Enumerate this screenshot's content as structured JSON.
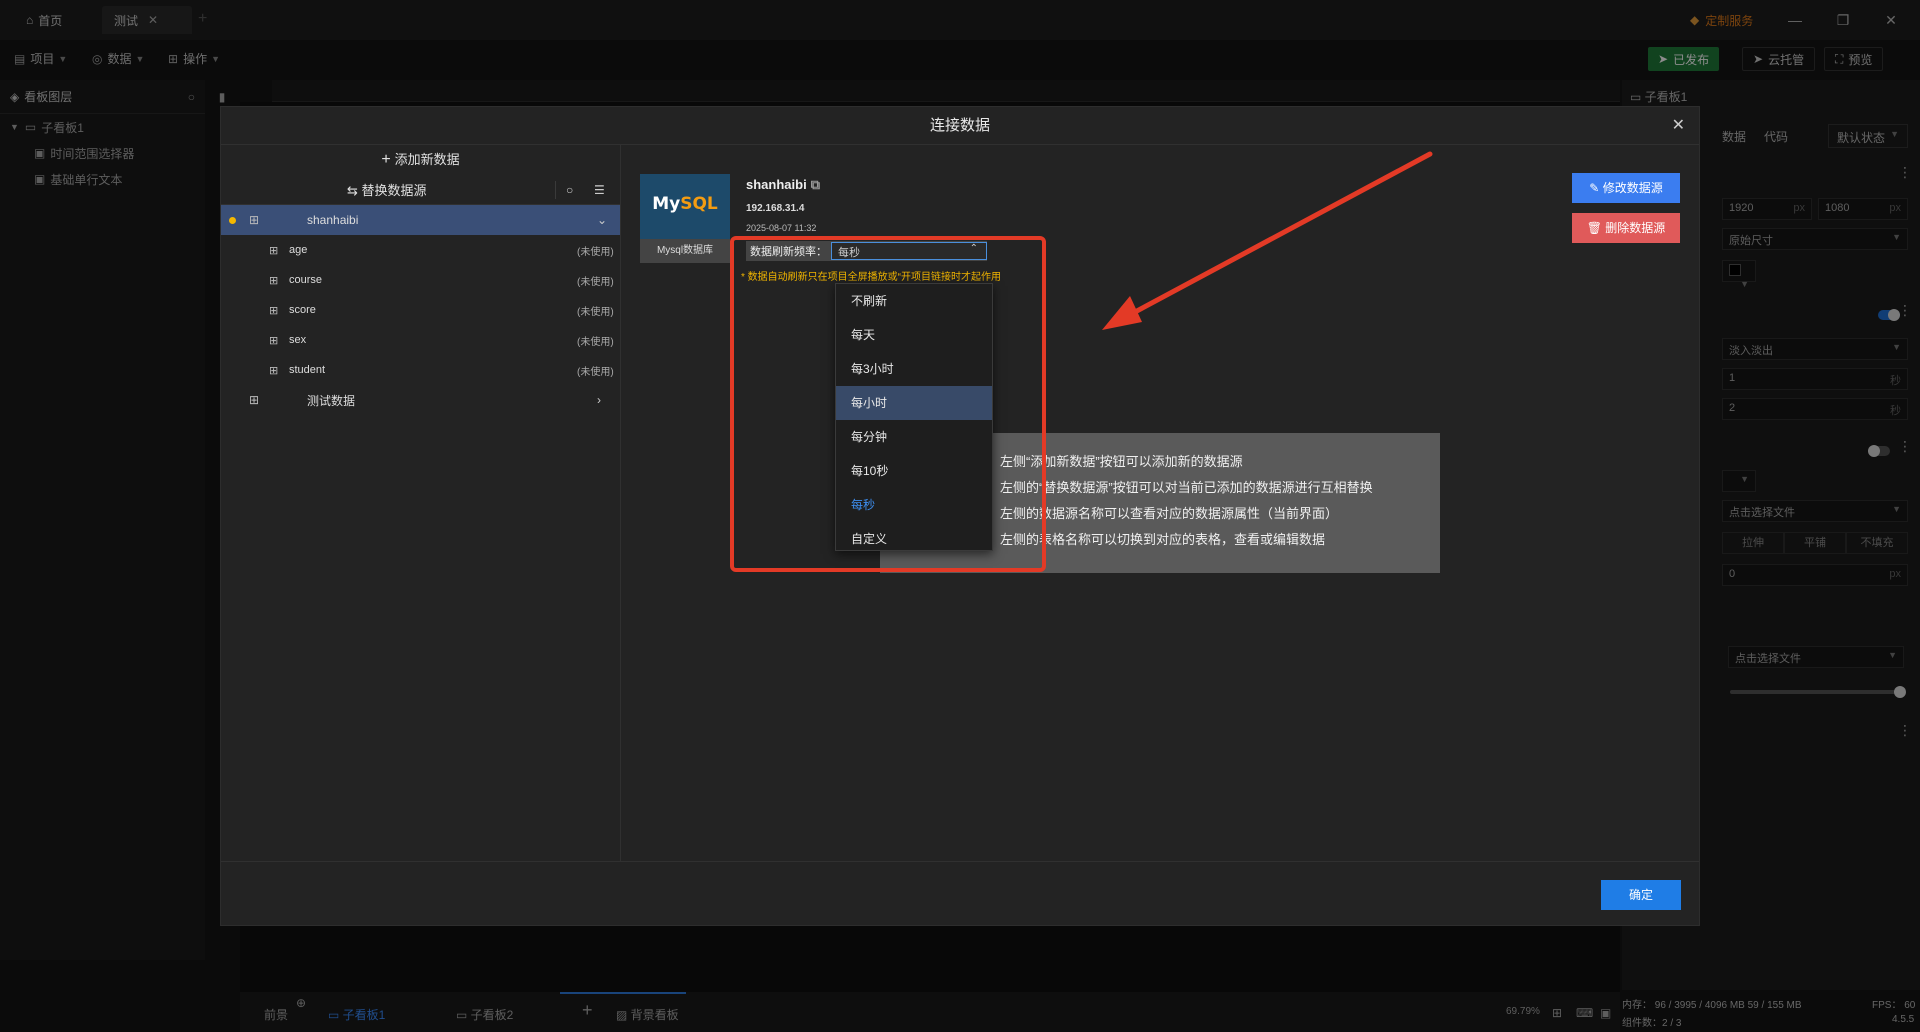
{
  "titlebar": {
    "tabs": [
      {
        "label": "首页"
      },
      {
        "label": "测试"
      }
    ],
    "service": "定制服务"
  },
  "toolbar": {
    "project": "项目",
    "data": "数据",
    "operation": "操作",
    "published": "已发布",
    "cloud": "云托管",
    "preview": "预览"
  },
  "layers": {
    "title": "看板图层",
    "root": "子看板1",
    "children": [
      "时间范围选择器",
      "基础单行文本"
    ]
  },
  "right_panel": {
    "title": "子看板1",
    "tabs": [
      "数据",
      "代码"
    ],
    "state": "默认状态",
    "width": "1920",
    "height": "1080",
    "unit_px": "px",
    "size_mode": "原始尺寸",
    "transition": "淡入淡出",
    "dur1": "1",
    "dur2": "2",
    "unit_s": "秒",
    "file1": "点击选择文件",
    "fill_modes": [
      "拉伸",
      "平铺",
      "不填充"
    ],
    "offset": "0",
    "file2": "点击选择文件"
  },
  "bottom": {
    "prev": "前景",
    "tab1": "子看板1",
    "tab2": "子看板2",
    "bg": "背景看板",
    "zoom": "69.79%"
  },
  "status": {
    "memory": "内存：  96 / 3995 / 4096 MB  59 / 155 MB",
    "fps": "FPS：  60",
    "components": "组件数：2 / 3",
    "version": "4.5.5"
  },
  "modal": {
    "title": "连接数据",
    "add_data": "添加新数据",
    "replace_source": "替换数据源",
    "datasources": [
      {
        "name": "shanhaibi",
        "expanded": true
      },
      {
        "name": "测试数据",
        "expanded": false
      }
    ],
    "tables": [
      {
        "name": "age",
        "status": "(未使用)"
      },
      {
        "name": "course",
        "status": "(未使用)"
      },
      {
        "name": "score",
        "status": "(未使用)"
      },
      {
        "name": "sex",
        "status": "(未使用)"
      },
      {
        "name": "student",
        "status": "(未使用)"
      }
    ],
    "db": {
      "logo_main": "My",
      "logo_sub": "SQL",
      "label": "Mysql数据库",
      "name": "shanhaibi",
      "ip": "192.168.31.4",
      "time": "2025-08-07 11:32"
    },
    "refresh_label": "数据刷新频率：",
    "refresh_value": "每秒",
    "note": "* 数据自动刷新只在项目全屏播放或“开项目链接时才起作用",
    "edit_button": "修改数据源",
    "delete_button": "删除数据源",
    "ok_button": "确定",
    "help_lines": [
      "左侧“添加新数据”按钮可以添加新的数据源",
      "左侧的“替换数据源”按钮可以对当前已添加的数据源进行互相替换",
      "左侧的数据源名称可以查看对应的数据源属性（当前界面）",
      "左侧的表格名称可以切换到对应的表格，查看或编辑数据"
    ],
    "refresh_options": [
      "不刷新",
      "每天",
      "每3小时",
      "每小时",
      "每分钟",
      "每10秒",
      "每秒",
      "自定义"
    ]
  },
  "colors": {
    "accent": "#1f7de6",
    "highlight_box": "#e33a26",
    "selected_row": "#3a4f77",
    "warning": "#f0b400"
  }
}
